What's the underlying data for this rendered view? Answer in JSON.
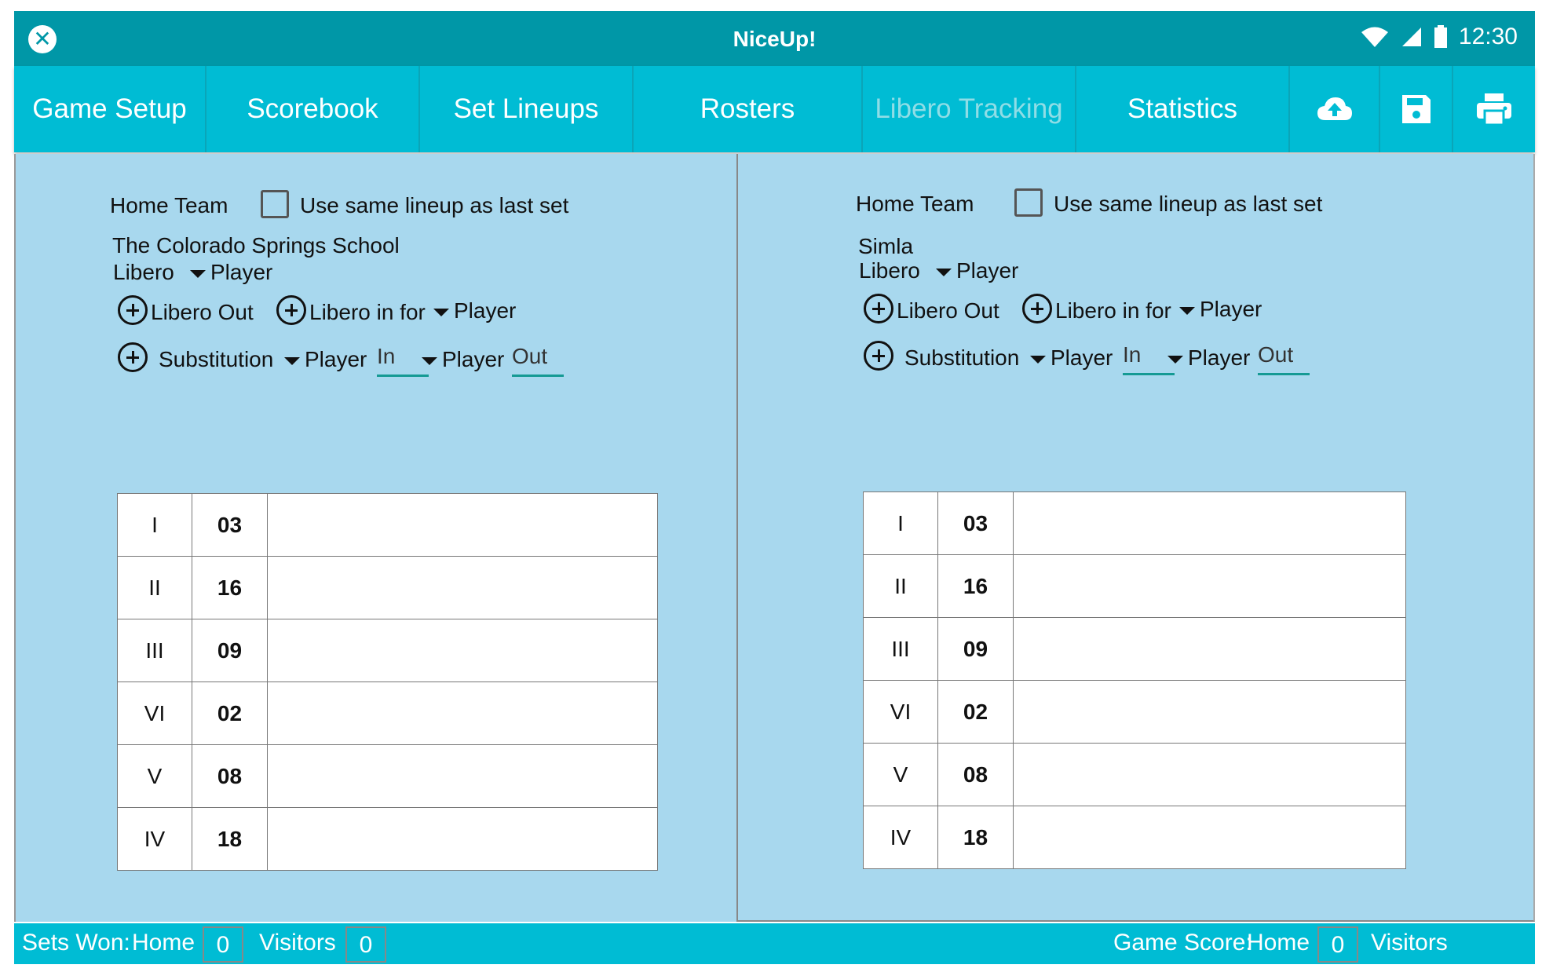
{
  "app": {
    "title": "NiceUp!",
    "time": "12:30"
  },
  "tabs": [
    "Game Setup",
    "Scorebook",
    "Set Lineups",
    "Rosters",
    "Libero Tracking",
    "Statistics"
  ],
  "icons": {
    "close": "close-icon",
    "upload": "cloud-upload-icon",
    "save": "save-icon",
    "print": "print-icon"
  },
  "colors": {
    "statusbar": "#0097a7",
    "tabbar": "#00bcd4",
    "panel": "#a8d8ee",
    "underline": "#159a94"
  },
  "left": {
    "team_label": "Home Team",
    "same_lineup": "Use same lineup as last set",
    "school": "The Colorado Springs School",
    "libero_label": "Libero",
    "player": "Player",
    "libero_out": "Libero Out",
    "libero_in_for": "Libero in for",
    "substitution": "Substitution",
    "in_placeholder": "In",
    "out_placeholder": "Out",
    "rows": [
      {
        "pos": "I",
        "num": "03",
        "name": ""
      },
      {
        "pos": "II",
        "num": "16",
        "name": ""
      },
      {
        "pos": "III",
        "num": "09",
        "name": ""
      },
      {
        "pos": "VI",
        "num": "02",
        "name": ""
      },
      {
        "pos": "V",
        "num": "08",
        "name": ""
      },
      {
        "pos": "IV",
        "num": "18",
        "name": ""
      }
    ]
  },
  "right": {
    "team_label": "Home Team",
    "same_lineup": "Use same lineup as last set",
    "school": "Simla",
    "libero_label": "Libero",
    "player": "Player",
    "libero_out": "Libero Out",
    "libero_in_for": "Libero in for",
    "substitution": "Substitution",
    "in_placeholder": "In",
    "out_placeholder": "Out",
    "rows": [
      {
        "pos": "I",
        "num": "03",
        "name": ""
      },
      {
        "pos": "II",
        "num": "16",
        "name": ""
      },
      {
        "pos": "III",
        "num": "09",
        "name": ""
      },
      {
        "pos": "VI",
        "num": "02",
        "name": ""
      },
      {
        "pos": "V",
        "num": "08",
        "name": ""
      },
      {
        "pos": "IV",
        "num": "18",
        "name": ""
      }
    ]
  },
  "footer": {
    "sets_won": "Sets Won:",
    "home": "Home",
    "visitors": "Visitors",
    "sets_home": "0",
    "sets_visitors": "0",
    "game_score": "Game Score:",
    "score_home": "0"
  }
}
